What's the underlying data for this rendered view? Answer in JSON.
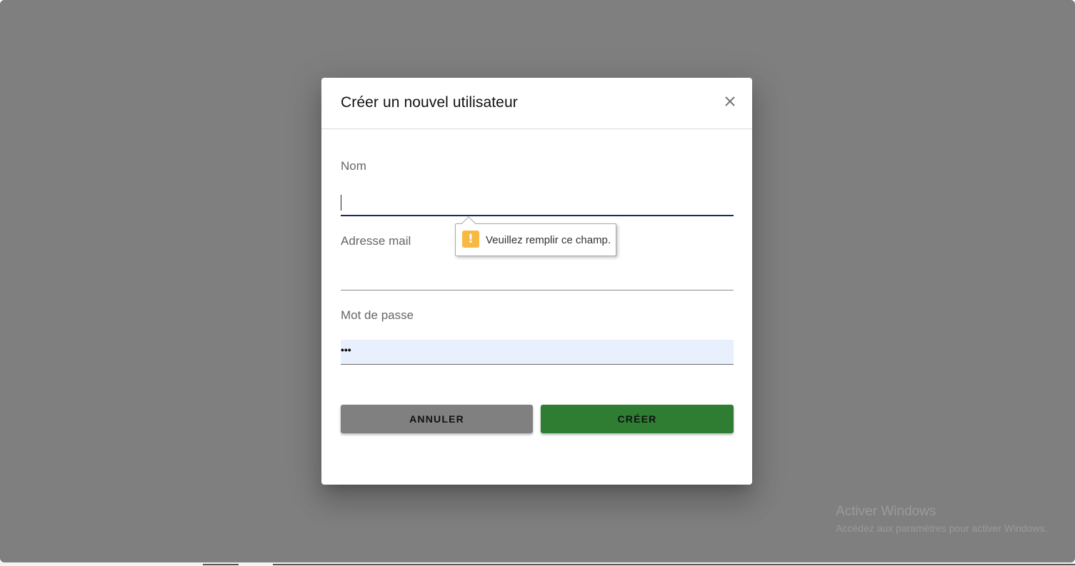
{
  "dialog": {
    "title": "Créer un nouvel utilisateur",
    "close_icon": "close-icon",
    "fields": {
      "name": {
        "label": "Nom",
        "value": ""
      },
      "email": {
        "label": "Adresse mail",
        "value": ""
      },
      "password": {
        "label": "Mot de passe",
        "masked_value": "•••"
      }
    },
    "validation_tooltip": {
      "icon": "warning-icon",
      "icon_color": "#f7b942",
      "text": "Veuillez remplir ce champ."
    },
    "buttons": {
      "cancel_label": "ANNULER",
      "create_label": "CRÉER",
      "cancel_color": "#808080",
      "create_color": "#2e7d32"
    }
  },
  "watermark": {
    "title": "Activer Windows",
    "subtitle": "Accédez aux paramètres pour activer Windows."
  }
}
